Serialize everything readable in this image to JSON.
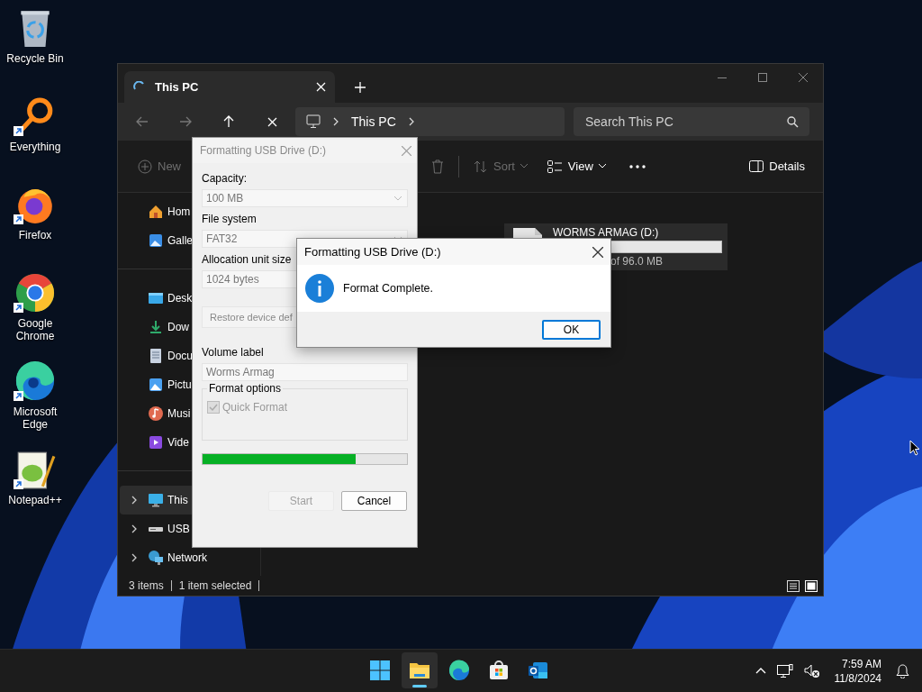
{
  "desktop_icons": [
    {
      "label": "Recycle Bin",
      "kind": "recycle",
      "shortcut": false
    },
    {
      "label": "Everything",
      "kind": "everything",
      "shortcut": true
    },
    {
      "label": "Firefox",
      "kind": "firefox",
      "shortcut": true
    },
    {
      "label": "Google Chrome",
      "kind": "chrome",
      "shortcut": true
    },
    {
      "label": "Microsoft Edge",
      "kind": "edge",
      "shortcut": true
    },
    {
      "label": "Notepad++",
      "kind": "notepad",
      "shortcut": true
    }
  ],
  "explorer": {
    "tab": {
      "title": "This PC"
    },
    "breadcrumb": [
      "This PC"
    ],
    "search": {
      "placeholder": "Search This PC"
    },
    "commands": [
      {
        "kind": "new",
        "label": "New",
        "disabled": true
      },
      {
        "kind": "delete",
        "disabled": true
      },
      {
        "kind": "sort",
        "label": "Sort",
        "disabled": true
      },
      {
        "kind": "view",
        "label": "View",
        "disabled": false
      },
      {
        "kind": "more",
        "disabled": false
      }
    ],
    "details_button": "Details",
    "sidebar": [
      {
        "items": [
          {
            "label": "Hom",
            "kind": "home",
            "selected": false
          },
          {
            "label": "Galle",
            "kind": "gallery",
            "selected": false
          }
        ]
      },
      {
        "items": [
          {
            "label": "Desk",
            "kind": "desktop",
            "selected": false
          },
          {
            "label": "Dow",
            "kind": "download",
            "selected": false
          },
          {
            "label": "Docu",
            "kind": "document",
            "selected": false
          },
          {
            "label": "Pictu",
            "kind": "pictures",
            "selected": false
          },
          {
            "label": "Musi",
            "kind": "music",
            "selected": false
          },
          {
            "label": "Vide",
            "kind": "video",
            "selected": false
          }
        ]
      },
      {
        "items": [
          {
            "label": "This",
            "kind": "pc",
            "selected": true,
            "expanded": false
          },
          {
            "label": "USB",
            "kind": "usb",
            "selected": false,
            "expanded": false
          },
          {
            "label": "Network",
            "kind": "network",
            "selected": false,
            "expanded": false
          }
        ]
      }
    ],
    "drive": {
      "name": "WORMS ARMAG (D:)",
      "capacity": "of 96.0 MB"
    },
    "status_bar": {
      "items": "3 items",
      "selection": "1 item selected"
    }
  },
  "format_dialog": {
    "title": "Formatting USB Drive (D:)",
    "active": false,
    "fields": [
      {
        "label": "Capacity:",
        "value": "100 MB",
        "kind": "dropdown"
      },
      {
        "label": "File system",
        "value": "FAT32",
        "kind": "dropdown"
      },
      {
        "label": "Allocation unit size",
        "value": "1024 bytes",
        "kind": "dropdown"
      }
    ],
    "restore_button": "Restore device def",
    "volume": {
      "label": "Volume label",
      "value": "Worms Armag"
    },
    "options": {
      "title": "Format options",
      "quick_format": {
        "label": "Quick Format",
        "checked": true,
        "disabled": true
      }
    },
    "progress": {
      "level": 0.75
    },
    "buttons": [
      {
        "label": "Start",
        "disabled": true
      },
      {
        "label": "Cancel",
        "disabled": false
      }
    ]
  },
  "message_box": {
    "title": "Formatting USB Drive (D:)",
    "active": true,
    "message": "Format Complete.",
    "button": "OK"
  },
  "taskbar": {
    "apps": [
      {
        "kind": "start",
        "selected": false
      },
      {
        "kind": "explorer",
        "selected": true
      },
      {
        "kind": "edge",
        "selected": false
      },
      {
        "kind": "store",
        "selected": false
      },
      {
        "kind": "outlook",
        "selected": false
      }
    ],
    "time": "7:59 AM",
    "date": "11/8/2024"
  }
}
